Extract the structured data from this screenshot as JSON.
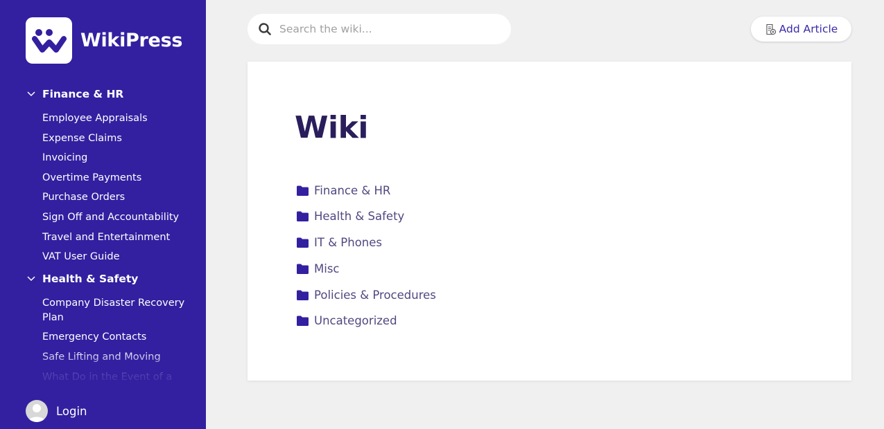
{
  "brand": {
    "name": "WikiPress"
  },
  "sidebar": {
    "groups": [
      {
        "label": "Finance & HR",
        "items": [
          "Employee Appraisals",
          "Expense Claims",
          "Invoicing",
          "Overtime Payments",
          "Purchase Orders",
          "Sign Off and Accountability",
          "Travel and Entertainment",
          "VAT User Guide"
        ]
      },
      {
        "label": "Health & Safety",
        "items": [
          "Company Disaster Recovery Plan",
          "Emergency Contacts",
          "Safe Lifting and Moving",
          "What Do in the Event of a"
        ]
      }
    ],
    "login_label": "Login"
  },
  "search": {
    "placeholder": "Search the wiki..."
  },
  "toolbar": {
    "add_article_label": "Add Article"
  },
  "main": {
    "title": "Wiki",
    "categories": [
      "Finance & HR",
      "Health & Safety",
      "IT & Phones",
      "Misc",
      "Policies & Procedures",
      "Uncategorized"
    ]
  },
  "colors": {
    "sidebar_bg": "#3220a0",
    "accent": "#3a2aa8",
    "title": "#2a1e5c",
    "category_text": "#4f4880",
    "page_bg": "#f0f0f0"
  },
  "icons": {
    "logo": "wikipress-logo-icon",
    "chevron": "chevron-down-icon",
    "search": "search-icon",
    "add_article": "document-add-icon",
    "folder": "folder-icon",
    "avatar": "user-avatar-icon"
  }
}
